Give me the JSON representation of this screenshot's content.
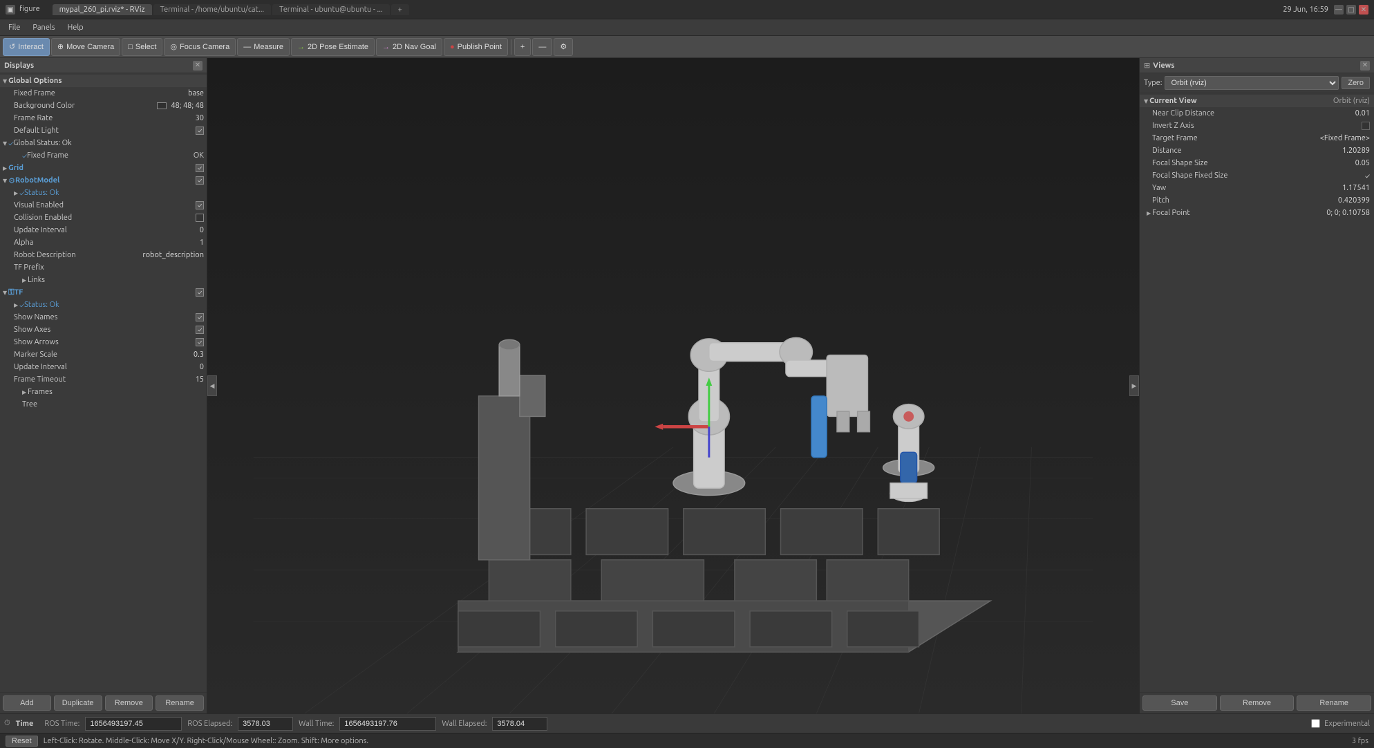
{
  "titlebar": {
    "appname": "figure",
    "title": "mypal_260_pi.rviz* - RViz",
    "tabs": [
      "mypal_260_pi.rviz* - RViz",
      "Terminal - /home/ubuntu/cat...",
      "Terminal - ubuntu@ubuntu - ..."
    ],
    "time": "29 Jun, 16:59"
  },
  "menubar": {
    "items": [
      "File",
      "Panels",
      "Help"
    ]
  },
  "toolbar": {
    "buttons": [
      {
        "label": "Interact",
        "active": true,
        "icon": "↺"
      },
      {
        "label": "Move Camera",
        "active": false,
        "icon": "⊕"
      },
      {
        "label": "Select",
        "active": false,
        "icon": "□"
      },
      {
        "label": "Focus Camera",
        "active": false,
        "icon": "◎"
      },
      {
        "label": "Measure",
        "active": false,
        "icon": "—"
      },
      {
        "label": "2D Pose Estimate",
        "active": false,
        "icon": "→"
      },
      {
        "label": "2D Nav Goal",
        "active": false,
        "icon": "→"
      },
      {
        "label": "Publish Point",
        "active": false,
        "icon": "●"
      },
      {
        "label": "+",
        "active": false,
        "icon": "+"
      },
      {
        "label": "—",
        "active": false,
        "icon": "—"
      },
      {
        "label": "⚙",
        "active": false,
        "icon": "⚙"
      }
    ]
  },
  "displays": {
    "title": "Displays",
    "sections": [
      {
        "name": "Global Options",
        "expanded": true,
        "items": [
          {
            "label": "Fixed Frame",
            "value": "base",
            "type": "text"
          },
          {
            "label": "Background Color",
            "value": "48; 48; 48",
            "type": "color",
            "color": "#303030"
          },
          {
            "label": "Frame Rate",
            "value": "30",
            "type": "text"
          },
          {
            "label": "Default Light",
            "value": "",
            "type": "checkbox",
            "checked": true
          }
        ]
      },
      {
        "name": "Global Status: Ok",
        "expanded": true,
        "isStatus": true,
        "items": [
          {
            "label": "Fixed Frame",
            "value": "OK",
            "type": "text",
            "indent": 1
          }
        ]
      },
      {
        "name": "Grid",
        "expanded": false,
        "isPlugin": true,
        "checked": true,
        "checkValue": true
      },
      {
        "name": "RobotModel",
        "expanded": true,
        "isPlugin": true,
        "checked": true,
        "checkValue": true,
        "items": [
          {
            "label": "Status: Ok",
            "value": "",
            "type": "status",
            "indent": 1
          },
          {
            "label": "Visual Enabled",
            "value": "",
            "type": "checkbox",
            "checked": true,
            "indent": 0
          },
          {
            "label": "Collision Enabled",
            "value": "",
            "type": "checkbox",
            "checked": false,
            "indent": 0
          },
          {
            "label": "Update Interval",
            "value": "0",
            "type": "text",
            "indent": 0
          },
          {
            "label": "Alpha",
            "value": "1",
            "type": "text",
            "indent": 0
          },
          {
            "label": "Robot Description",
            "value": "robot_description",
            "type": "text",
            "indent": 0
          },
          {
            "label": "TF Prefix",
            "value": "",
            "type": "text",
            "indent": 0
          }
        ]
      },
      {
        "name": "Links",
        "expanded": false,
        "isSubItem": true
      },
      {
        "name": "TF",
        "expanded": true,
        "isPlugin": true,
        "checked": true,
        "checkValue": true,
        "items": [
          {
            "label": "Status: Ok",
            "value": "",
            "type": "status",
            "indent": 1
          },
          {
            "label": "Show Names",
            "value": "",
            "type": "checkbox",
            "checked": true,
            "indent": 0
          },
          {
            "label": "Show Axes",
            "value": "",
            "type": "checkbox",
            "checked": true,
            "indent": 0
          },
          {
            "label": "Show Arrows",
            "value": "",
            "type": "checkbox",
            "checked": true,
            "indent": 0
          },
          {
            "label": "Marker Scale",
            "value": "0.3",
            "type": "text",
            "indent": 0
          },
          {
            "label": "Update Interval",
            "value": "0",
            "type": "text",
            "indent": 0
          },
          {
            "label": "Frame Timeout",
            "value": "15",
            "type": "text",
            "indent": 0
          }
        ]
      },
      {
        "name": "Frames",
        "expanded": false,
        "isSubItem": true
      },
      {
        "name": "Tree",
        "isSubItem": true
      }
    ],
    "buttons": [
      "Add",
      "Duplicate",
      "Remove",
      "Rename"
    ]
  },
  "views": {
    "title": "Views",
    "type_label": "Type:",
    "type_value": "Orbit (rviz)",
    "zero_button": "Zero",
    "current_view": {
      "title": "Current View",
      "type": "Orbit (rviz)",
      "properties": [
        {
          "label": "Near Clip Distance",
          "value": "0.01"
        },
        {
          "label": "Invert Z Axis",
          "value": ""
        },
        {
          "label": "Target Frame",
          "value": "<Fixed Frame>"
        },
        {
          "label": "Distance",
          "value": "1.20289"
        },
        {
          "label": "Focal Shape Size",
          "value": "0.05"
        },
        {
          "label": "Focal Shape Fixed Size",
          "value": "✓"
        },
        {
          "label": "Yaw",
          "value": "1.17541"
        },
        {
          "label": "Pitch",
          "value": "0.420399"
        },
        {
          "label": "Focal Point",
          "value": "0; 0; 0.10758",
          "expandable": true
        }
      ]
    },
    "buttons": [
      "Save",
      "Remove",
      "Rename"
    ]
  },
  "time_panel": {
    "title": "Time",
    "ros_time_label": "ROS Time:",
    "ros_time_value": "1656493197.45",
    "ros_elapsed_label": "ROS Elapsed:",
    "ros_elapsed_value": "3578.03",
    "wall_time_label": "Wall Time:",
    "wall_time_value": "1656493197.76",
    "wall_elapsed_label": "Wall Elapsed:",
    "wall_elapsed_value": "3578.04"
  },
  "statusbar": {
    "reset_label": "Reset",
    "help_text": "Left-Click: Rotate.  Middle-Click: Move X/Y.  Right-Click/Mouse Wheel:: Zoom.  Shift: More options.",
    "experimental_label": "Experimental",
    "fps": "3 fps"
  }
}
